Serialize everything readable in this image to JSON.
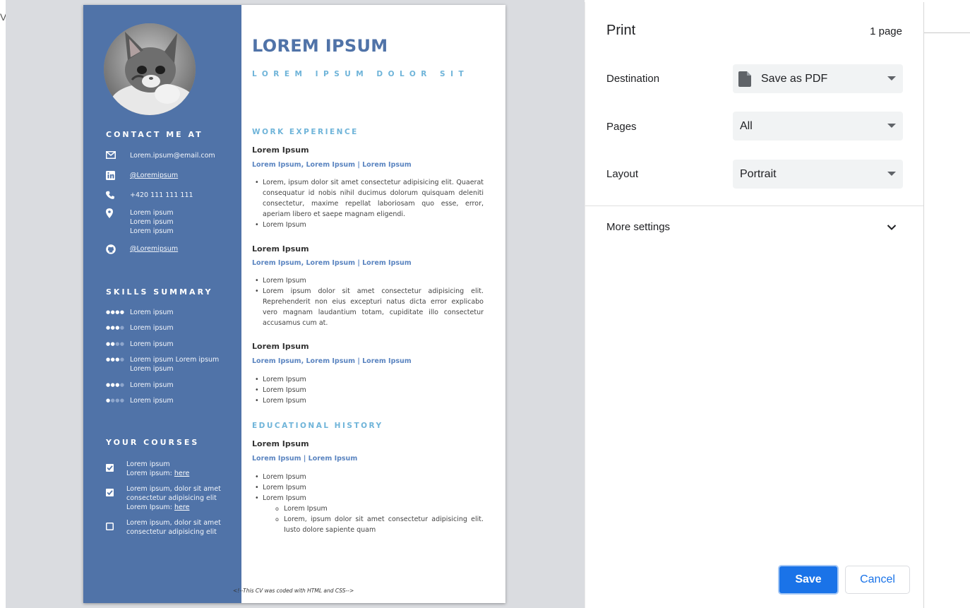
{
  "edge_text": "Va",
  "cv": {
    "name": "LOREM IPSUM",
    "tagline": "LOREM IPSUM DOLOR SIT",
    "contact_heading": "CONTACT ME AT",
    "contact": {
      "email": "Lorem.ipsum@email.com",
      "linkedin": "@Loremipsum",
      "phone": "+420 111 111 111",
      "address": [
        "Lorem ipsum",
        "Lorem ipsum",
        "Lorem ipsum"
      ],
      "github": "@Loremipsum"
    },
    "skills_heading": "SKILLS SUMMARY",
    "skills": [
      {
        "label": "Lorem ipsum",
        "level": 4
      },
      {
        "label": "Lorem ipsum",
        "level": 3
      },
      {
        "label": "Lorem ipsum",
        "level": 2
      },
      {
        "label": "Lorem ipsum Lorem ipsum Lorem ipsum",
        "level": 3
      },
      {
        "label": "Lorem ipsum",
        "level": 3
      },
      {
        "label": "Lorem ipsum",
        "level": 1
      }
    ],
    "skill_max": 4,
    "courses_heading": "YOUR COURSES",
    "courses": {
      "c1_line1": "Lorem ipsum",
      "c1_line2_prefix": "Lorem ipsum: ",
      "c1_link": "here",
      "c1_checked": true,
      "c2_line1": "Lorem ipsum, dolor sit amet",
      "c2_line2": "consectetur adipisicing elit",
      "c2_line3_prefix": "Lorem Ipsum: ",
      "c2_link": "here",
      "c2_checked": true,
      "c3_line1": "Lorem ipsum, dolor sit amet",
      "c3_line2": "consectetur adipisicing elit",
      "c3_checked": false
    },
    "work_heading": "WORK EXPERIENCE",
    "jobs": [
      {
        "title": "Lorem Ipsum",
        "subtitle": "Lorem Ipsum, Lorem Ipsum | Lorem Ipsum",
        "bullets": [
          "Lorem, ipsum dolor sit amet consectetur adipisicing elit. Quaerat consequatur id nobis nihil ducimus dolorum quisquam deleniti consectetur, maxime repellat laboriosam quo esse, error, aperiam libero et saepe magnam eligendi.",
          "Lorem Ipsum"
        ]
      },
      {
        "title": "Lorem Ipsum",
        "subtitle": "Lorem Ipsum, Lorem Ipsum | Lorem Ipsum",
        "bullets": [
          "Lorem Ipsum",
          "Lorem ipsum dolor sit amet consectetur adipisicing elit. Reprehenderit non eius excepturi natus dicta error explicabo vero magnam laudantium totam, cupiditate illo consectetur accusamus cum at."
        ]
      },
      {
        "title": "Lorem Ipsum",
        "subtitle": "Lorem Ipsum, Lorem Ipsum | Lorem Ipsum",
        "bullets": [
          "Lorem Ipsum",
          "Lorem Ipsum",
          "Lorem Ipsum"
        ]
      }
    ],
    "edu_heading": "EDUCATIONAL HISTORY",
    "edu": {
      "title": "Lorem Ipsum",
      "subtitle": "Lorem Ipsum | Lorem Ipsum",
      "bullets": [
        "Lorem Ipsum",
        "Lorem Ipsum",
        "Lorem Ipsum"
      ],
      "sub_bullets": [
        "Lorem Ipsum",
        "Lorem, ipsum dolor sit amet consectetur adipisicing elit. Iusto dolore sapiente quam"
      ]
    },
    "footer": "<!--This CV was coded with HTML and CSS-->"
  },
  "print": {
    "title": "Print",
    "page_count": "1 page",
    "destination_label": "Destination",
    "destination_value": "Save as PDF",
    "pages_label": "Pages",
    "pages_value": "All",
    "layout_label": "Layout",
    "layout_value": "Portrait",
    "more_settings": "More settings",
    "save": "Save",
    "cancel": "Cancel"
  },
  "colors": {
    "sidebar": "#5073a8",
    "accent": "#6fb4d9",
    "primary_button": "#1a73e8"
  }
}
